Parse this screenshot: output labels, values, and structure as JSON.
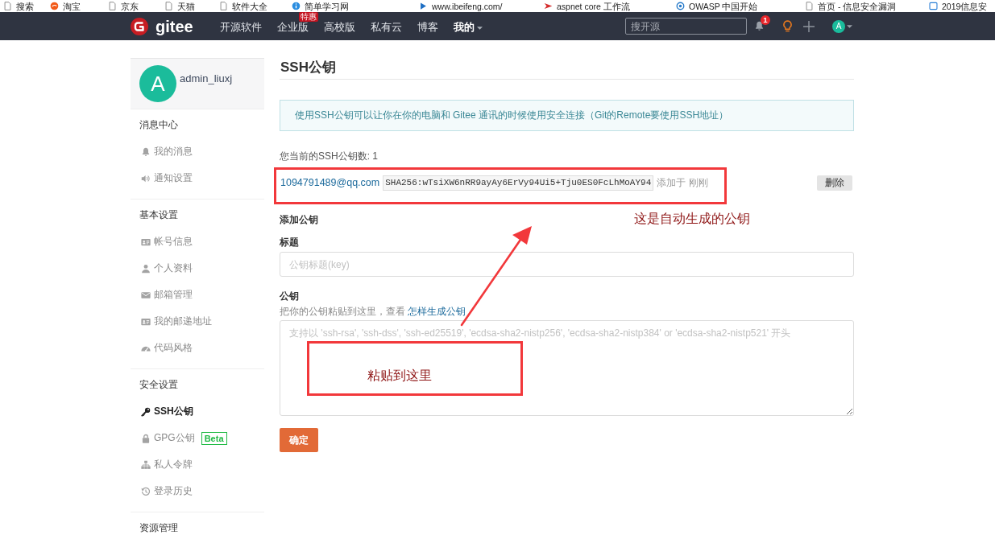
{
  "bookmarks": [
    {
      "label": "搜索"
    },
    {
      "label": "淘宝"
    },
    {
      "label": "京东"
    },
    {
      "label": "天猫"
    },
    {
      "label": "软件大全"
    },
    {
      "label": "简单学习网"
    },
    {
      "label": "www.ibeifeng.com/"
    },
    {
      "label": "aspnet core 工作流"
    },
    {
      "label": "OWASP 中国开始"
    },
    {
      "label": "首页 - 信息安全漏洞"
    },
    {
      "label": "2019信息安"
    }
  ],
  "header": {
    "logo": "gitee",
    "nav": [
      {
        "label": "开源软件",
        "kind": "link"
      },
      {
        "label": "企业版",
        "kind": "link",
        "badge": "特惠"
      },
      {
        "label": "高校版",
        "kind": "link"
      },
      {
        "label": "私有云",
        "kind": "link"
      },
      {
        "label": "博客",
        "kind": "link"
      },
      {
        "label": "我的",
        "kind": "menu"
      }
    ],
    "search": {
      "placeholder": "搜开源"
    },
    "notifications": {
      "count": "1"
    },
    "avatar": "A"
  },
  "sidebar": {
    "user": {
      "avatar": "A",
      "name": "admin_liuxj"
    },
    "groups": [
      {
        "title": "消息中心",
        "items": [
          {
            "label": "我的消息",
            "selected": false
          },
          {
            "label": "通知设置",
            "selected": false
          }
        ]
      },
      {
        "title": "基本设置",
        "items": [
          {
            "label": "帐号信息",
            "selected": false
          },
          {
            "label": "个人资料",
            "selected": false
          },
          {
            "label": "邮箱管理",
            "selected": false
          },
          {
            "label": "我的邮递地址",
            "selected": false
          },
          {
            "label": "代码风格",
            "selected": false
          }
        ]
      },
      {
        "title": "安全设置",
        "items": [
          {
            "label": "SSH公钥",
            "selected": true
          },
          {
            "label": "GPG公钥",
            "selected": false,
            "badge": "Beta"
          },
          {
            "label": "私人令牌",
            "selected": false
          },
          {
            "label": "登录历史",
            "selected": false
          }
        ]
      },
      {
        "title": "资源管理"
      }
    ]
  },
  "main": {
    "title": "SSH公钥",
    "notice": "使用SSH公钥可以让你在你的电脑和 Gitee 通讯的时候使用安全连接（Git的Remote要使用SSH地址）",
    "key_count": "您当前的SSH公钥数: 1",
    "keys": [
      {
        "name": "1094791489@qq.com",
        "fingerprint": "SHA256:wTsiXW6nRR9ayAy6ErVy94Ui5+Tju0ES0FcLhMoAY94",
        "added": "添加于 刚刚",
        "delete_button": "删除"
      }
    ],
    "form": {
      "heading": "添加公钥",
      "title_label": "标题",
      "title_field": {
        "placeholder": "公钥标题(key)"
      },
      "key_label": "公钥",
      "hint": "把你的公钥粘贴到这里，查看 ",
      "hint_link": "怎样生成公钥",
      "key_field": {
        "placeholder": "支持以 'ssh-rsa', 'ssh-dss', 'ssh-ed25519', 'ecdsa-sha2-nistp256', 'ecdsa-sha2-nistp384' or 'ecdsa-sha2-nistp521' 开头"
      },
      "submit": "确定"
    }
  },
  "annotations": {
    "key_note": "这是自动生成的公钥",
    "paste_note": "粘贴到这里"
  }
}
